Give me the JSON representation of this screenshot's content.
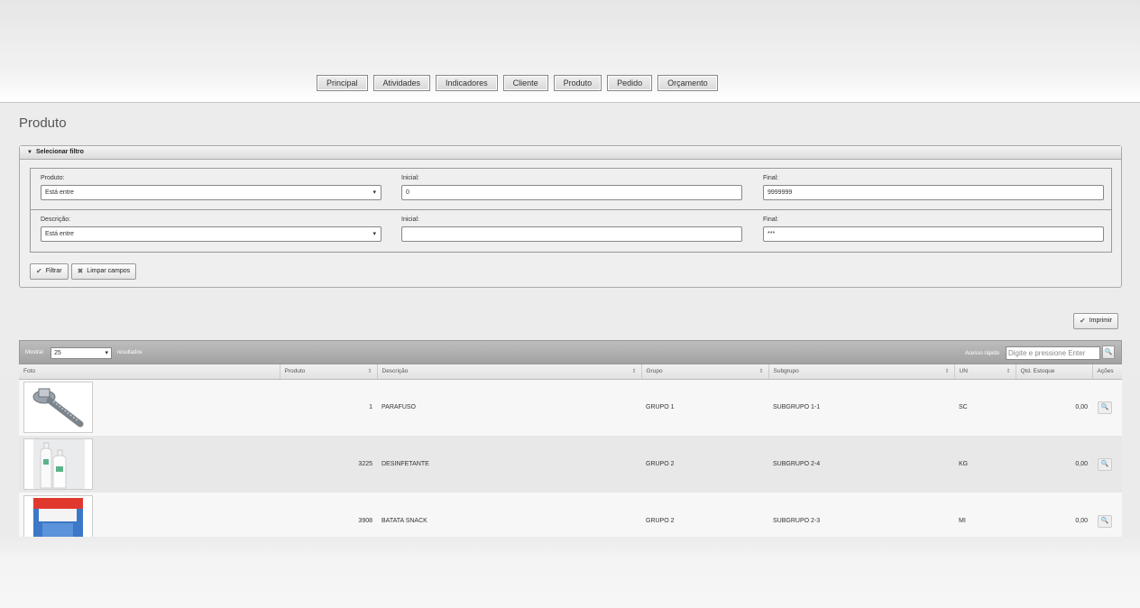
{
  "nav": {
    "items": [
      {
        "label": "Principal"
      },
      {
        "label": "Atividades"
      },
      {
        "label": "Indicadores"
      },
      {
        "label": "Cliente"
      },
      {
        "label": "Produto"
      },
      {
        "label": "Pedido"
      },
      {
        "label": "Orçamento"
      }
    ]
  },
  "page": {
    "title": "Produto"
  },
  "filter": {
    "header": "Selecionar filtro",
    "rows": [
      {
        "field_label": "Produto:",
        "operator": "Está entre",
        "initial_label": "Inicial:",
        "initial_value": "0",
        "final_label": "Final:",
        "final_value": "9999999"
      },
      {
        "field_label": "Descrição:",
        "operator": "Está entre",
        "initial_label": "Inicial:",
        "initial_value": "",
        "final_label": "Final:",
        "final_value": "***"
      }
    ],
    "filter_button": "Filtrar",
    "clear_button": "Limpar campos"
  },
  "print_button": "Imprimir",
  "table": {
    "show_label": "Mostrar",
    "page_size": "25",
    "results_label": "resultados",
    "quick_access_label": "Acesso rápido",
    "quick_access_placeholder": "Digite e pressione Enter",
    "columns": [
      "Foto",
      "Produto",
      "Descrição",
      "Grupo",
      "Subgrupo",
      "UN",
      "Qtd. Estoque",
      "Ações"
    ],
    "rows": [
      {
        "photo": "screw-image",
        "produto": "1",
        "descricao": "PARAFUSO",
        "grupo": "GRUPO 1",
        "subgrupo": "SUBGRUPO 1-1",
        "un": "SC",
        "qtd": "0,00"
      },
      {
        "photo": "bottles-image",
        "produto": "3225",
        "descricao": "DESINFETANTE",
        "grupo": "GRUPO 2",
        "subgrupo": "SUBGRUPO 2-4",
        "un": "KG",
        "qtd": "0,00"
      },
      {
        "photo": "snack-bag-image",
        "produto": "3908",
        "descricao": "BATATA SNACK",
        "grupo": "GRUPO 2",
        "subgrupo": "SUBGRUPO 2-3",
        "un": "MI",
        "qtd": "0,00"
      }
    ]
  }
}
